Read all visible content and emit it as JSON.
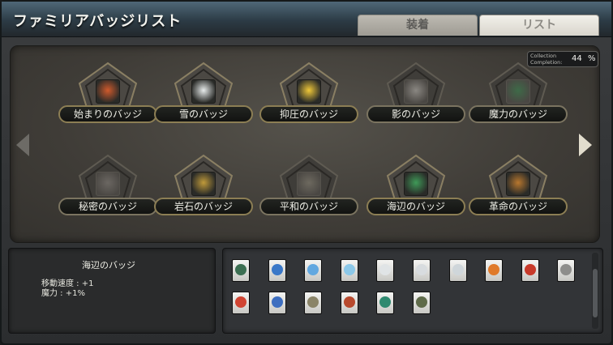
{
  "window": {
    "title": "ファミリアバッジリスト",
    "tabs": [
      {
        "label": "装着",
        "selected": false
      },
      {
        "label": "リスト",
        "selected": true
      }
    ]
  },
  "completion": {
    "label_line1": "Collection",
    "label_line2": "Completion:",
    "value": "44",
    "unit": "%"
  },
  "badges": [
    {
      "label": "始まりのバッジ",
      "icon": "familiar-group-icon",
      "unlocked": true,
      "icon_color": "#d05a2c"
    },
    {
      "label": "雪のバッジ",
      "icon": "snow-creatures-icon",
      "unlocked": true,
      "icon_color": "#e8ecec"
    },
    {
      "label": "抑圧のバッジ",
      "icon": "oppression-creatures-icon",
      "unlocked": true,
      "icon_color": "#f0c838"
    },
    {
      "label": "影のバッジ",
      "icon": "shadow-icon",
      "unlocked": false,
      "icon_color": "#8a8782"
    },
    {
      "label": "魔力のバッジ",
      "icon": "magic-circle-icon",
      "unlocked": false,
      "icon_color": "#3e6a48"
    },
    {
      "label": "秘密のバッジ",
      "icon": "skull-icon",
      "unlocked": false,
      "icon_color": "#6b6762"
    },
    {
      "label": "岩石のバッジ",
      "icon": "sun-face-icon",
      "unlocked": true,
      "icon_color": "#c09a3a"
    },
    {
      "label": "平和のバッジ",
      "icon": "shield-icon",
      "unlocked": false,
      "icon_color": "#6d695f"
    },
    {
      "label": "海辺のバッジ",
      "icon": "seaside-icon",
      "unlocked": true,
      "icon_color": "#3f9a58"
    },
    {
      "label": "革命のバッジ",
      "icon": "gear-icon",
      "unlocked": true,
      "icon_color": "#b8772e"
    }
  ],
  "selected_badge": {
    "name": "海辺のバッジ",
    "stats": [
      "移動速度 : +1",
      "魔力 : +1%"
    ]
  },
  "familiar_cards": [
    {
      "icon": "turtle-card-icon",
      "color": "#3c6f52"
    },
    {
      "icon": "blue-bird-card-icon",
      "color": "#3a78c8"
    },
    {
      "icon": "blue-ghost-card-icon",
      "color": "#62a8e0"
    },
    {
      "icon": "ice-ghost-card-icon",
      "color": "#8cc8e8"
    },
    {
      "icon": "white-ghost-card-icon",
      "color": "#e0e4e6"
    },
    {
      "icon": "white-ghost-card-icon",
      "color": "#d8dcdf"
    },
    {
      "icon": "snowman-card-icon",
      "color": "#cfd6da"
    },
    {
      "icon": "mushroom-card-icon",
      "color": "#e07a2a"
    },
    {
      "icon": "red-bird-card-icon",
      "color": "#c83a2a"
    },
    {
      "icon": "grey-beast-card-icon",
      "color": "#8e8e8c"
    },
    {
      "icon": "red-bird-card-icon",
      "color": "#d04432"
    },
    {
      "icon": "penguin-card-icon",
      "color": "#3d6ec0"
    },
    {
      "icon": "cat-card-icon",
      "color": "#8a8468"
    },
    {
      "icon": "owl-card-icon",
      "color": "#b84a2e"
    },
    {
      "icon": "fish-card-icon",
      "color": "#2f8a70"
    },
    {
      "icon": "goblin-card-icon",
      "color": "#5f6b4a"
    }
  ]
}
